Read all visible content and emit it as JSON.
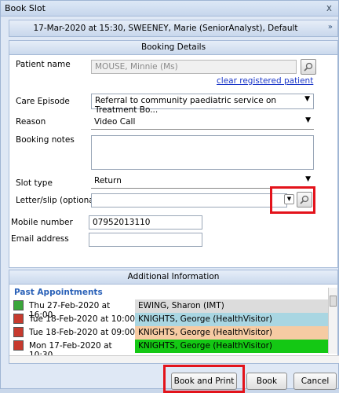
{
  "window": {
    "title": "Book Slot",
    "close_glyph": "x"
  },
  "slot": {
    "summary": "17-Mar-2020 at 15:30, SWEENEY, Marie (SeniorAnalyst), Default",
    "collapse_glyph": "»"
  },
  "booking": {
    "header": "Booking Details",
    "patient_label": "Patient name",
    "patient_value": "MOUSE, Minnie (Ms)",
    "clear_link": "clear registered patient",
    "care_label": "Care Episode",
    "care_value": "Referral to community paediatric service on Treatment Bo...",
    "reason_label": "Reason",
    "reason_value": "Video Call",
    "notes_label": "Booking notes",
    "notes_value": "",
    "slot_type_label": "Slot type",
    "slot_type_value": "Return",
    "letter_label": "Letter/slip (optional)",
    "letter_value": "",
    "mobile_label": "Mobile number",
    "mobile_value": "07952013110",
    "email_label": "Email address",
    "email_value": ""
  },
  "additional": {
    "header": "Additional Information",
    "past_label": "Past Appointments",
    "appointments": [
      {
        "date": "Thu 27-Feb-2020 at 16:00",
        "who": "EWING, Sharon (IMT)",
        "color": "#dcdcdc",
        "icon_color": "#3aa63a",
        "icon": "check-icon"
      },
      {
        "date": "Tue 18-Feb-2020 at 10:00",
        "who": "KNIGHTS, George (HealthVisitor)",
        "color": "#a9d6e2",
        "icon_color": "#c73a2e",
        "icon": "calendar-icon"
      },
      {
        "date": "Tue 18-Feb-2020 at 09:00",
        "who": "KNIGHTS, George (HealthVisitor)",
        "color": "#f6cba3",
        "icon_color": "#c73a2e",
        "icon": "calendar-icon"
      },
      {
        "date": "Mon 17-Feb-2020 at 10:30",
        "who": "KNIGHTS, George (HealthVisitor)",
        "color": "#14c814",
        "icon_color": "#c73a2e",
        "icon": "calendar-icon"
      }
    ]
  },
  "buttons": {
    "book_print": "Book and Print",
    "book": "Book",
    "cancel": "Cancel"
  },
  "colors": {
    "highlight": "#e3131b",
    "link": "#1a36c8",
    "section_title": "#2b62b8"
  },
  "icons": {
    "search": "search-icon",
    "dropdown": "chevron-down-icon"
  }
}
